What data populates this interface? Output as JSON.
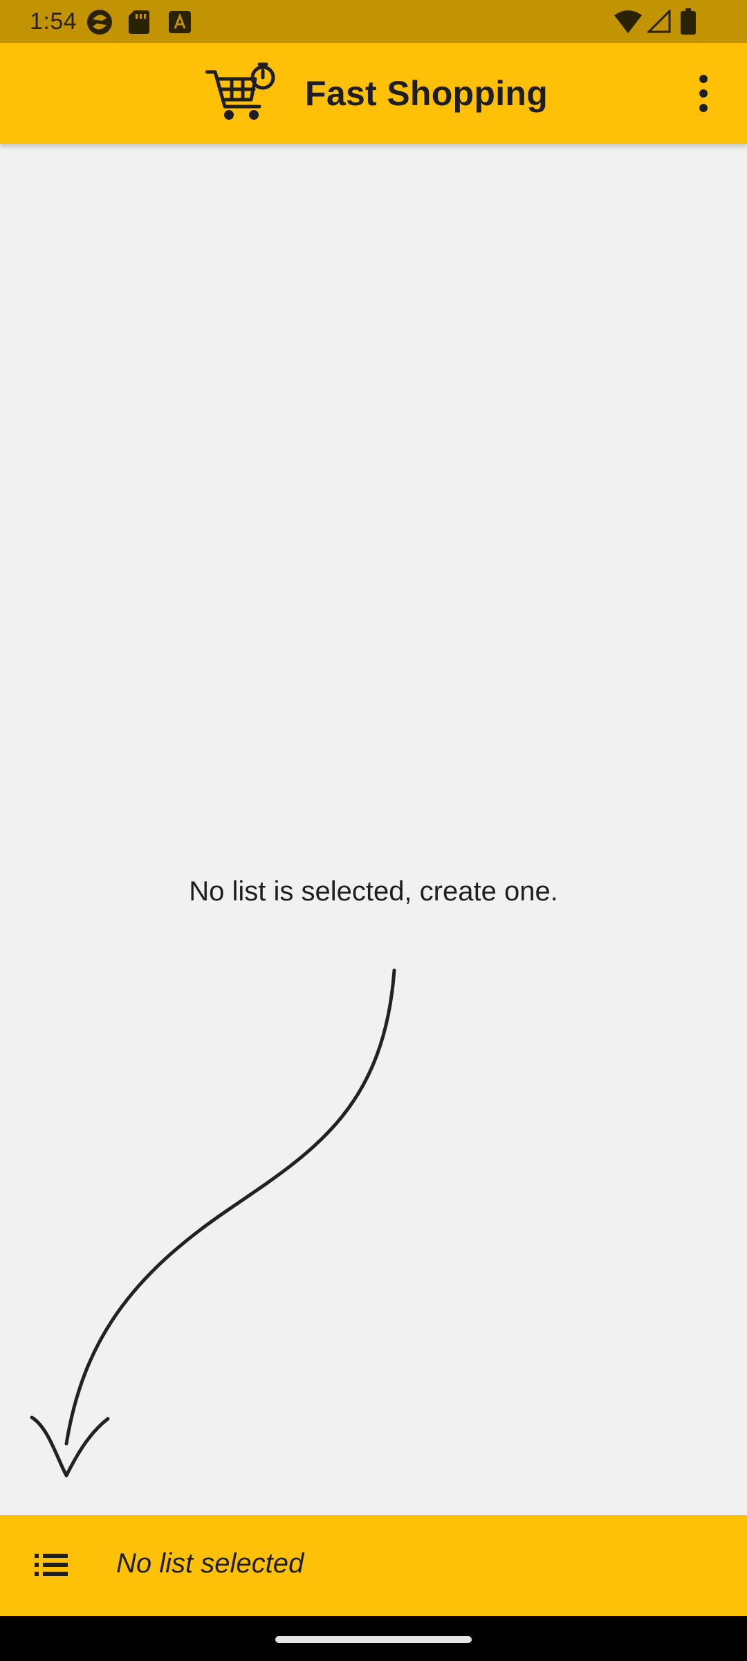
{
  "status_bar": {
    "time": "1:54"
  },
  "app_bar": {
    "title": "Fast Shopping",
    "logo": "shopping-cart-timer-icon",
    "menu_icon": "more-vert-icon"
  },
  "main": {
    "empty_message": "No list is selected, create one."
  },
  "bottom_bar": {
    "icon": "list-icon",
    "current_list": "No list selected"
  },
  "colors": {
    "accent": "#ffc107",
    "status_bar": "#c29303",
    "background": "#f1f1f1"
  }
}
